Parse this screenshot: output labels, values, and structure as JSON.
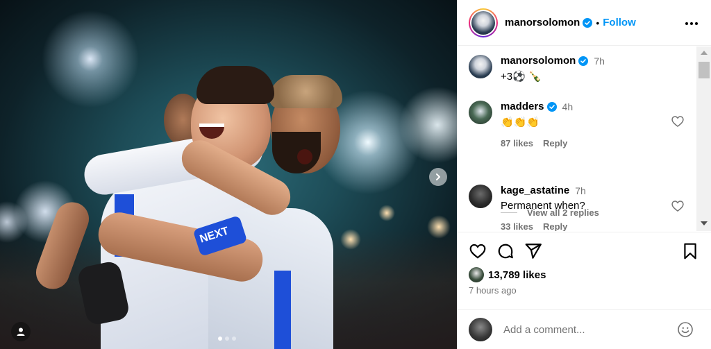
{
  "post": {
    "author": "manorsolomon",
    "follow_label": "Follow",
    "separator": "•",
    "likes_count": "13,789 likes",
    "time_ago": "7 hours ago",
    "carousel_pages": 3,
    "carousel_active": 1
  },
  "photo": {
    "sponsor_text": "NEXT"
  },
  "comments": [
    {
      "user": "manorsolomon",
      "verified": true,
      "time": "7h",
      "text": "+3⚽ 🍾",
      "likes": "",
      "reply": "",
      "heart": false
    },
    {
      "user": "madders",
      "verified": true,
      "time": "4h",
      "text": "👏👏👏",
      "likes": "87 likes",
      "reply": "Reply",
      "heart": true
    },
    {
      "user": "kage_astatine",
      "verified": false,
      "time": "7h",
      "text": "Permanent when?",
      "likes": "33 likes",
      "reply": "Reply",
      "heart": true
    }
  ],
  "view_replies": "View all 2 replies",
  "add_comment": {
    "placeholder": "Add a comment..."
  },
  "colors": {
    "accent": "#0095f6",
    "verified": "#0095f6",
    "muted": "#737373"
  }
}
